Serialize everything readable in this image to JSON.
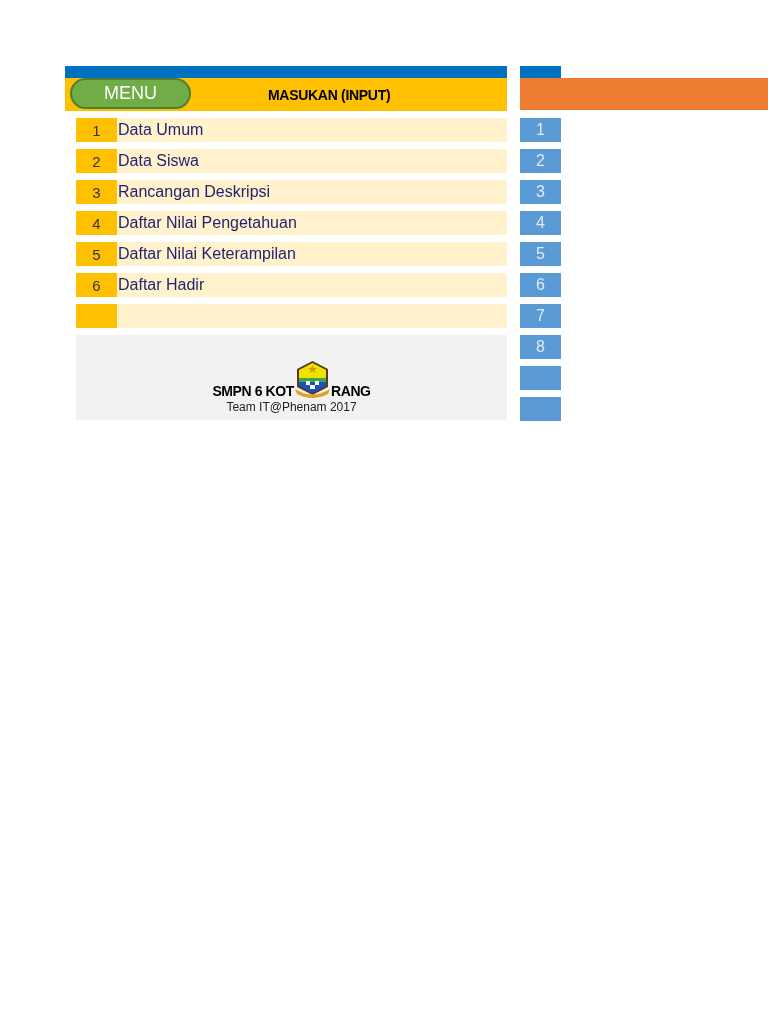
{
  "header": {
    "menu_button": "MENU",
    "title": "MASUKAN (INPUT)"
  },
  "input_menu": [
    {
      "kind": "entry",
      "number": "1",
      "label": "Data Umum"
    },
    {
      "kind": "entry",
      "number": "2",
      "label": "Data Siswa"
    },
    {
      "kind": "entry",
      "number": "3",
      "label": "Rancangan Deskripsi"
    },
    {
      "kind": "entry",
      "number": "4",
      "label": "Daftar Nilai Pengetahuan"
    },
    {
      "kind": "entry",
      "number": "5",
      "label": "Daftar Nilai Keterampilan"
    },
    {
      "kind": "entry",
      "number": "6",
      "label": "Daftar Hadir"
    },
    {
      "kind": "blank"
    }
  ],
  "footer": {
    "school_name_left": "SMPN 6 KOT",
    "school_name_right": "RANG",
    "credit": "Team IT@Phenam 2017"
  },
  "side_index": [
    {
      "kind": "numbered",
      "number": "1"
    },
    {
      "kind": "numbered",
      "number": "2"
    },
    {
      "kind": "numbered",
      "number": "3"
    },
    {
      "kind": "numbered",
      "number": "4"
    },
    {
      "kind": "numbered",
      "number": "5"
    },
    {
      "kind": "numbered",
      "number": "6"
    },
    {
      "kind": "numbered",
      "number": "7"
    },
    {
      "kind": "numbered",
      "number": "8"
    },
    {
      "kind": "blank"
    },
    {
      "kind": "blank"
    }
  ]
}
